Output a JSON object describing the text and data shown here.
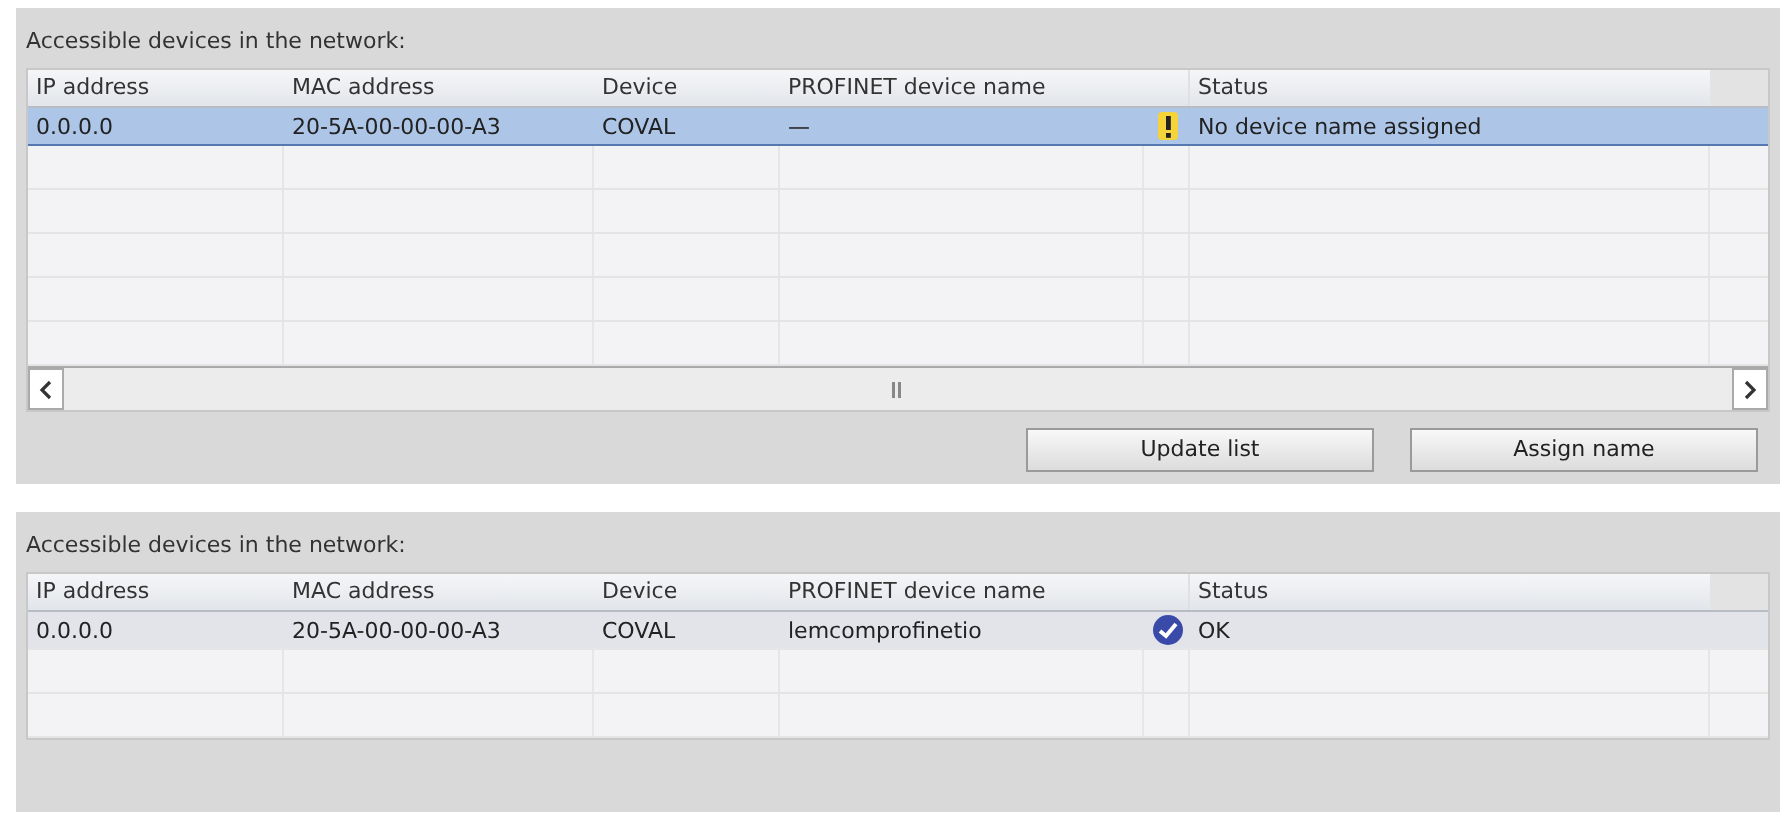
{
  "panels": [
    {
      "label": "Accessible devices in the network:",
      "columns": [
        "IP address",
        "MAC address",
        "Device",
        "PROFINET device name",
        "Status"
      ],
      "rows": [
        {
          "ip": "0.0.0.0",
          "mac": "20-5A-00-00-00-A3",
          "device": "COVAL",
          "profinet_name": "—",
          "kind": "warning",
          "status": "No device name assigned",
          "selected": true
        }
      ],
      "buttons": [
        "Update list",
        "Assign name"
      ]
    },
    {
      "label": "Accessible devices in the network:",
      "columns": [
        "IP address",
        "MAC address",
        "Device",
        "PROFINET device name",
        "Status"
      ],
      "rows": [
        {
          "ip": "0.0.0.0",
          "mac": "20-5A-00-00-00-A3",
          "device": "COVAL",
          "profinet_name": "lemcomprofinetio",
          "kind": "ok",
          "status": "OK",
          "selected": false
        }
      ]
    }
  ]
}
